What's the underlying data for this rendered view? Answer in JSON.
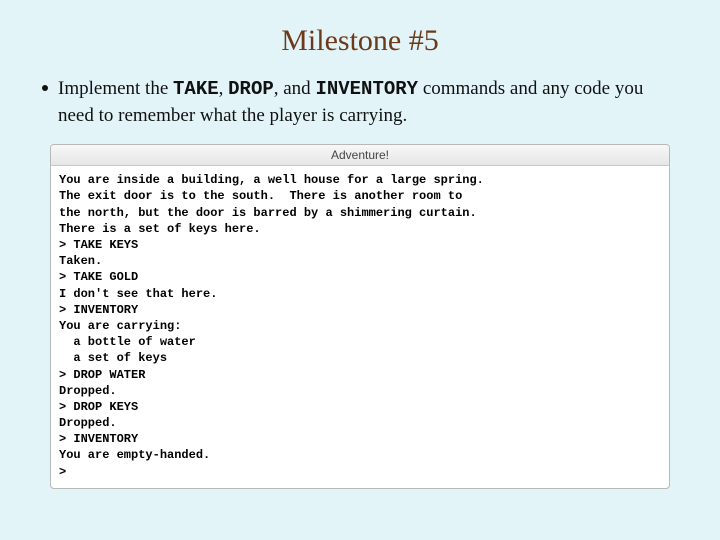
{
  "title": "Milestone #5",
  "bullet": {
    "pre": "Implement the ",
    "cmd1": "TAKE",
    "sep1": ", ",
    "cmd2": "DROP",
    "sep2": ", and ",
    "cmd3": "INVENTORY",
    "post": " commands and any code you need to remember what the player is carrying."
  },
  "console": {
    "window_title": "Adventure!",
    "lines": [
      "You are inside a building, a well house for a large spring.",
      "The exit door is to the south.  There is another room to",
      "the north, but the door is barred by a shimmering curtain.",
      "There is a set of keys here.",
      "> TAKE KEYS",
      "Taken.",
      "> TAKE GOLD",
      "I don't see that here.",
      "> INVENTORY",
      "You are carrying:",
      "  a bottle of water",
      "  a set of keys",
      "> DROP WATER",
      "Dropped.",
      "> DROP KEYS",
      "Dropped.",
      "> INVENTORY",
      "You are empty-handed.",
      "> "
    ]
  }
}
